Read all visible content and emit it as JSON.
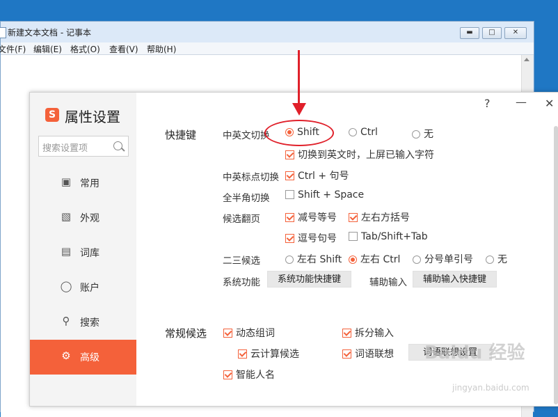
{
  "notepad": {
    "title": "新建文本文档 - 记事本",
    "menu": [
      "文件(F)",
      "编辑(E)",
      "格式(O)",
      "查看(V)",
      "帮助(H)"
    ],
    "window_buttons": [
      "minimize",
      "restore",
      "close"
    ]
  },
  "dialog": {
    "logo_glyph": "S",
    "title": "属性设置",
    "search_placeholder": "搜索设置项",
    "help_icon": "?",
    "minimize_icon": "—",
    "close_icon": "✕",
    "nav": [
      {
        "label": "常用",
        "icon": "monitor-icon",
        "active": false
      },
      {
        "label": "外观",
        "icon": "shirt-icon",
        "active": false
      },
      {
        "label": "词库",
        "icon": "book-icon",
        "active": false
      },
      {
        "label": "账户",
        "icon": "user-icon",
        "active": false
      },
      {
        "label": "搜索",
        "icon": "search-icon",
        "active": false
      },
      {
        "label": "高级",
        "icon": "gear-icon",
        "active": true
      }
    ],
    "shortcuts": {
      "section": "快捷键",
      "cn_en_switch": {
        "label": "中英文切换",
        "options": [
          "Shift",
          "Ctrl",
          "无"
        ],
        "selected": "Shift",
        "sub_check": {
          "label": "切换到英文时，上屏已输入字符",
          "checked": true
        }
      },
      "punct_switch": {
        "label": "中英标点切换",
        "option": "Ctrl + 句号",
        "checked": true
      },
      "width_switch": {
        "label": "全半角切换",
        "option": "Shift + Space",
        "checked": false
      },
      "paging": {
        "label": "候选翻页",
        "options": [
          {
            "label": "减号等号",
            "checked": true
          },
          {
            "label": "左右方括号",
            "checked": true
          },
          {
            "label": "逗号句号",
            "checked": true
          },
          {
            "label": "Tab/Shift+Tab",
            "checked": false
          }
        ]
      },
      "second_third": {
        "label": "二三候选",
        "options": [
          "左右 Shift",
          "左右 Ctrl",
          "分号单引号",
          "无"
        ],
        "selected": "左右 Ctrl"
      },
      "system_func": {
        "label": "系统功能",
        "button": "系统功能快捷键"
      },
      "aux_input": {
        "label": "辅助输入",
        "button": "辅助输入快捷键"
      }
    },
    "candidates": {
      "section": "常规候选",
      "items": [
        {
          "label": "动态组词",
          "checked": true
        },
        {
          "label": "拆分输入",
          "checked": true
        },
        {
          "label": "云计算候选",
          "checked": true
        },
        {
          "label": "词语联想",
          "checked": true
        },
        {
          "label": "智能人名",
          "checked": true
        }
      ],
      "button": "词语联想设置"
    }
  },
  "watermark": {
    "text": "Baidu 经验",
    "sub": "jingyan.baidu.com"
  },
  "colors": {
    "accent": "#f4613a",
    "annotation": "#e0202a"
  }
}
